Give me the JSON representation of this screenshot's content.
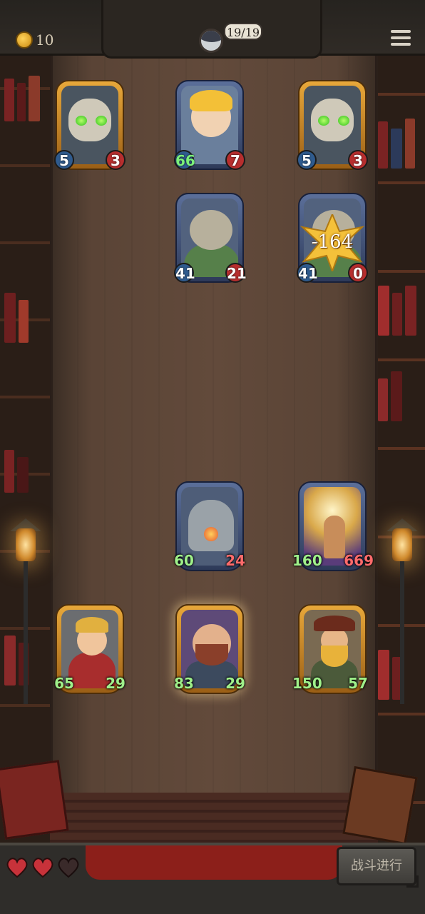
{
  "topbar": {
    "coins": "10",
    "turn_counter": "19/19"
  },
  "enemy_row1": [
    {
      "name": "skull-knight-left",
      "atk": "5",
      "hp": "3"
    },
    {
      "name": "blond-kid",
      "atk": "66",
      "hp": "7"
    },
    {
      "name": "skull-knight-right",
      "atk": "5",
      "hp": "3"
    }
  ],
  "enemy_row2": [
    {
      "name": "orc-brute-left",
      "atk": "41",
      "hp": "21"
    },
    {
      "name": "orc-brute-right",
      "atk": "41",
      "hp": "0"
    }
  ],
  "damage_popup": "-164",
  "player_row1": [
    {
      "name": "robot-furnace",
      "atk": "60",
      "hp": "24"
    },
    {
      "name": "radiant-mage",
      "atk": "160",
      "hp": "669"
    }
  ],
  "player_row2": [
    {
      "name": "red-scarf-hero",
      "atk": "65",
      "hp": "29"
    },
    {
      "name": "bearded-giant",
      "atk": "83",
      "hp": "29"
    },
    {
      "name": "pirate-captain",
      "atk": "150",
      "hp": "57"
    }
  ],
  "bottombar": {
    "lives_total": 3,
    "lives_remaining": 2,
    "battle_button_label": "战斗进行"
  },
  "colors": {
    "gold_frame": "#e8a83a",
    "blue_frame": "#5b6f9a",
    "attack_badge": "#2f5b8e",
    "health_badge": "#b72e2e",
    "buff_text": "#9ff08a"
  }
}
